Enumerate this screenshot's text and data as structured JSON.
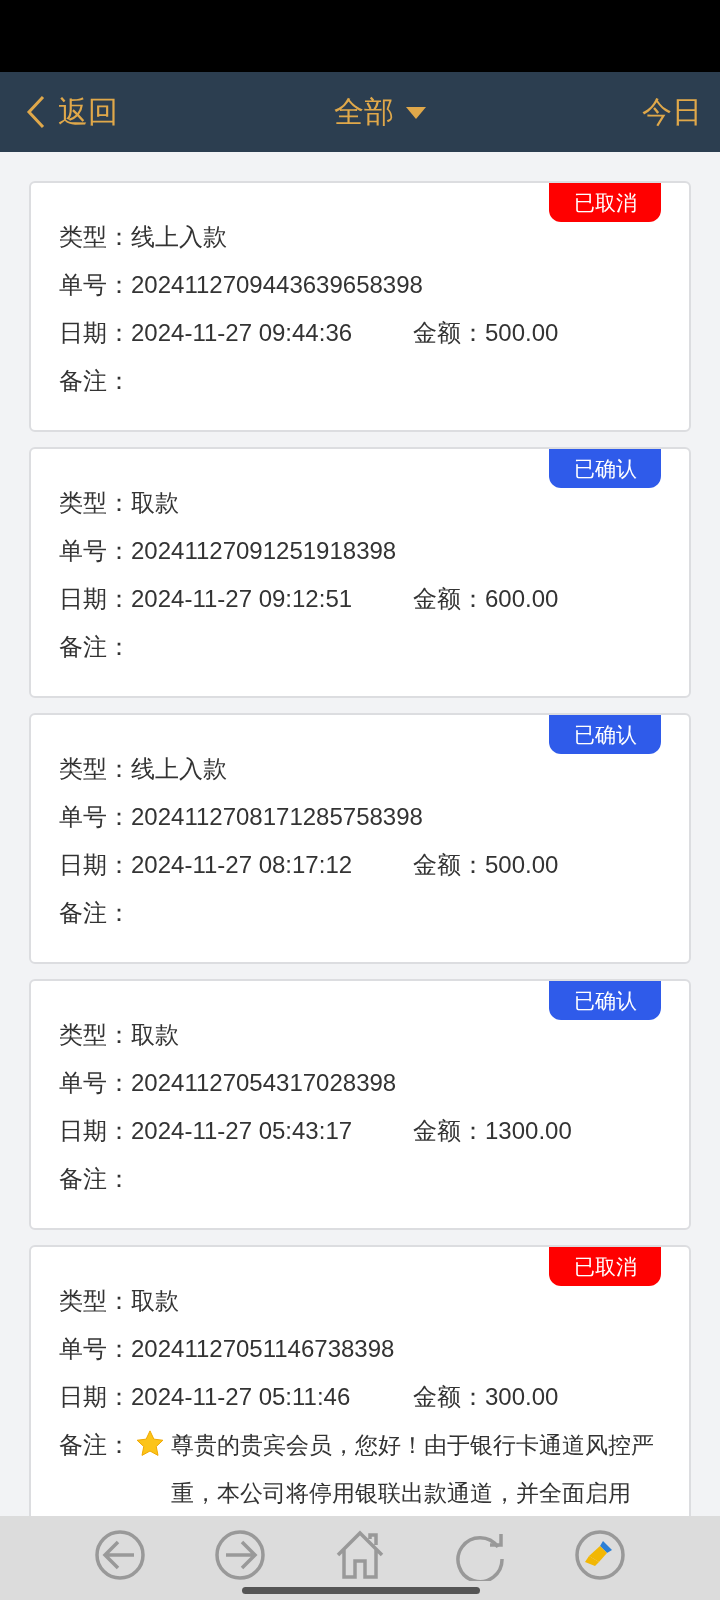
{
  "header": {
    "back": "返回",
    "title": "全部",
    "today": "今日"
  },
  "records": [
    {
      "status": {
        "label": "已取消",
        "color": "#ff0000"
      },
      "type_label": "类型：",
      "type": "线上入款",
      "no_label": "单号：",
      "no": "2024112709443639658398",
      "date_label": "日期：",
      "date": "2024-11-27 09:44:36",
      "amount_label": "金额：",
      "amount": "500.00",
      "note_label": "备注："
    },
    {
      "status": {
        "label": "已确认",
        "color": "#2f5bea"
      },
      "type_label": "类型：",
      "type": "取款",
      "no_label": "单号：",
      "no": "20241127091251918398",
      "date_label": "日期：",
      "date": "2024-11-27 09:12:51",
      "amount_label": "金额：",
      "amount": "600.00",
      "note_label": "备注："
    },
    {
      "status": {
        "label": "已确认",
        "color": "#2f5bea"
      },
      "type_label": "类型：",
      "type": "线上入款",
      "no_label": "单号：",
      "no": "2024112708171285758398",
      "date_label": "日期：",
      "date": "2024-11-27 08:17:12",
      "amount_label": "金额：",
      "amount": "500.00",
      "note_label": "备注："
    },
    {
      "status": {
        "label": "已确认",
        "color": "#2f5bea"
      },
      "type_label": "类型：",
      "type": "取款",
      "no_label": "单号：",
      "no": "20241127054317028398",
      "date_label": "日期：",
      "date": "2024-11-27 05:43:17",
      "amount_label": "金额：",
      "amount": "1300.00",
      "note_label": "备注："
    },
    {
      "status": {
        "label": "已取消",
        "color": "#ff0000"
      },
      "type_label": "类型：",
      "type": "取款",
      "no_label": "单号：",
      "no": "20241127051146738398",
      "date_label": "日期：",
      "date": "2024-11-27 05:11:46",
      "amount_label": "金额：",
      "amount": "300.00",
      "note_label": "备注：",
      "note": "尊贵的贵宾会员，您好！由于银行卡通道风控严重，本公司将停用银联出款通道，并全面启用"
    }
  ]
}
